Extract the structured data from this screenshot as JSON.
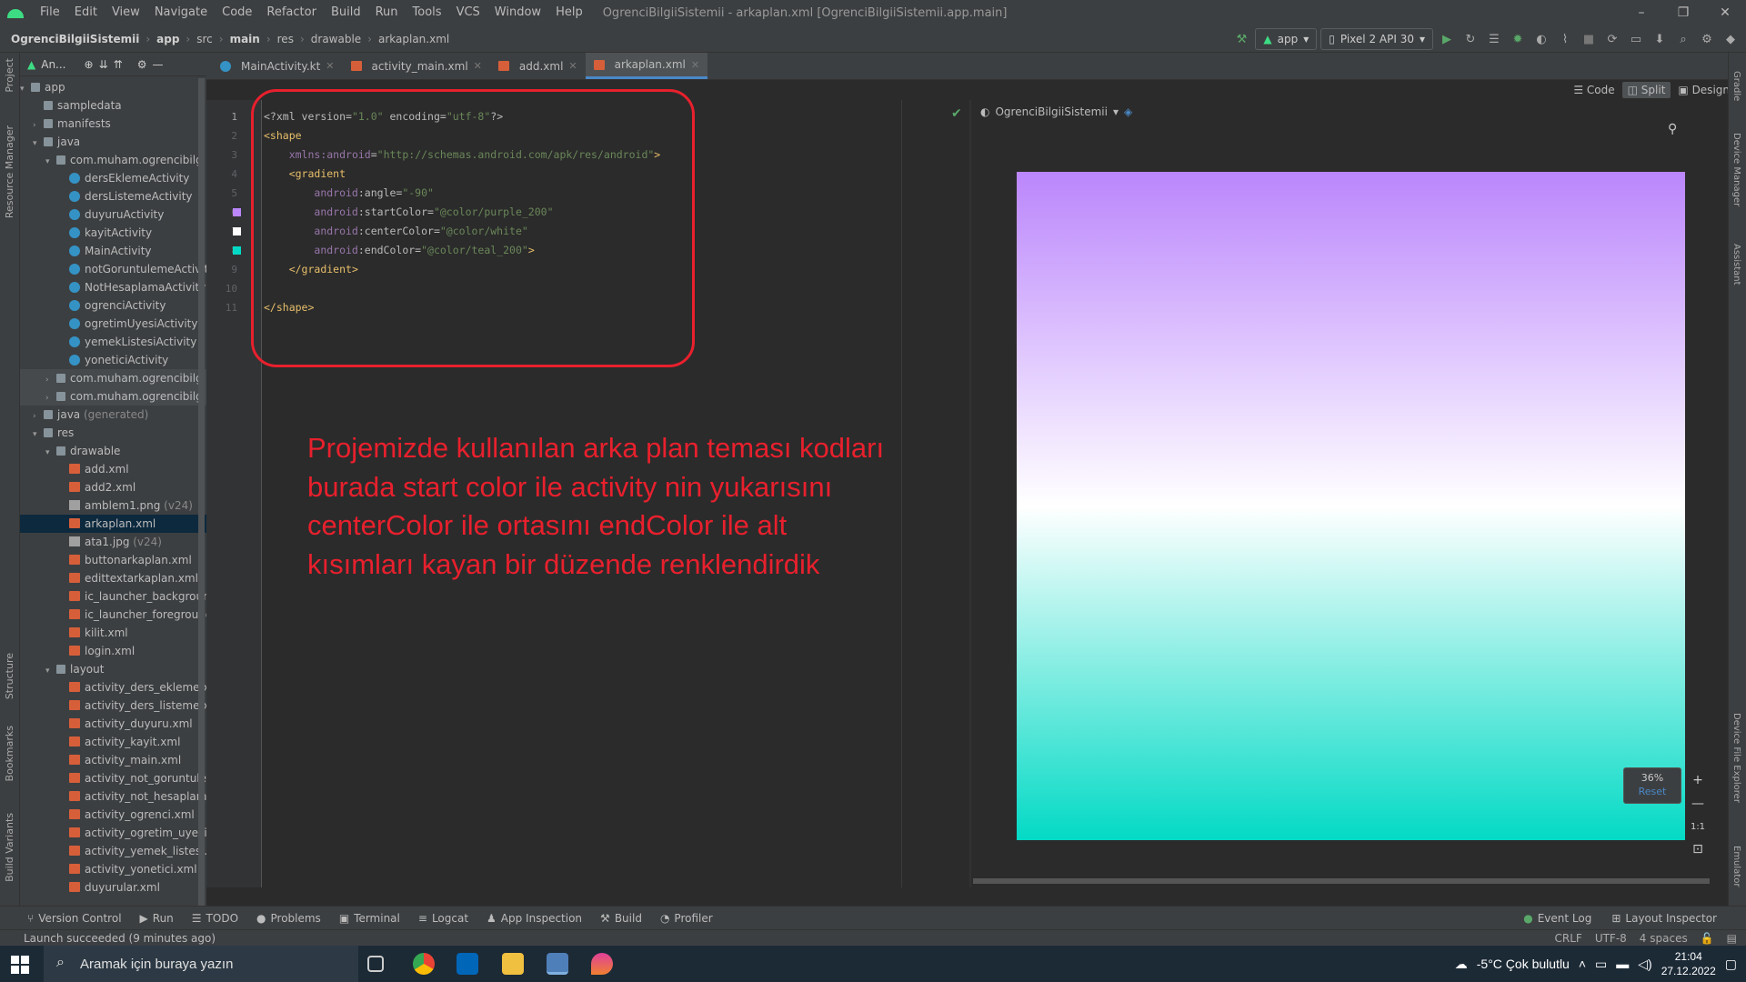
{
  "window": {
    "menu": [
      "File",
      "Edit",
      "View",
      "Navigate",
      "Code",
      "Refactor",
      "Build",
      "Run",
      "Tools",
      "VCS",
      "Window",
      "Help"
    ],
    "title": "OgrenciBilgiiSistemii - arkaplan.xml [OgrenciBilgiiSistemii.app.main]",
    "controls": [
      "–",
      "❐",
      "✕"
    ]
  },
  "breadcrumb": [
    "OgrenciBilgiiSistemii",
    "app",
    "src",
    "main",
    "res",
    "drawable",
    "arkaplan.xml"
  ],
  "run_config": {
    "module": "app",
    "device": "Pixel 2 API 30"
  },
  "project_panel": {
    "header": "An...",
    "tree": [
      {
        "label": "app",
        "indent": 0,
        "type": "folder",
        "arrow": "▾"
      },
      {
        "label": "sampledata",
        "indent": 1,
        "type": "folder",
        "arrow": ""
      },
      {
        "label": "manifests",
        "indent": 1,
        "type": "folder",
        "arrow": "›"
      },
      {
        "label": "java",
        "indent": 1,
        "type": "folder",
        "arrow": "▾"
      },
      {
        "label": "com.muham.ogrencibilgiisist",
        "indent": 2,
        "type": "folder",
        "arrow": "▾"
      },
      {
        "label": "dersEklemeActivity",
        "indent": 3,
        "type": "kt"
      },
      {
        "label": "dersListemeActivity",
        "indent": 3,
        "type": "kt"
      },
      {
        "label": "duyuruActivity",
        "indent": 3,
        "type": "kt"
      },
      {
        "label": "kayitActivity",
        "indent": 3,
        "type": "kt"
      },
      {
        "label": "MainActivity",
        "indent": 3,
        "type": "kt"
      },
      {
        "label": "notGoruntulemeActivity",
        "indent": 3,
        "type": "kt"
      },
      {
        "label": "NotHesaplamaActivity",
        "indent": 3,
        "type": "kt"
      },
      {
        "label": "ogrenciActivity",
        "indent": 3,
        "type": "kt"
      },
      {
        "label": "ogretimUyesiActivity",
        "indent": 3,
        "type": "kt"
      },
      {
        "label": "yemekListesiActivity",
        "indent": 3,
        "type": "kt"
      },
      {
        "label": "yoneticiActivity",
        "indent": 3,
        "type": "kt"
      },
      {
        "label": "com.muham.ogrencibilgiisist",
        "indent": 2,
        "type": "folder",
        "arrow": "›",
        "alt": true
      },
      {
        "label": "com.muham.ogrencibilgiisist",
        "indent": 2,
        "type": "folder",
        "arrow": "›",
        "alt": true
      },
      {
        "label": "java",
        "suffix": " (generated)",
        "indent": 1,
        "type": "folder",
        "arrow": "›"
      },
      {
        "label": "res",
        "indent": 1,
        "type": "folder",
        "arrow": "▾"
      },
      {
        "label": "drawable",
        "indent": 2,
        "type": "folder",
        "arrow": "▾"
      },
      {
        "label": "add.xml",
        "indent": 3,
        "type": "xml"
      },
      {
        "label": "add2.xml",
        "indent": 3,
        "type": "xml"
      },
      {
        "label": "amblem1.png",
        "suffix": " (v24)",
        "indent": 3,
        "type": "img"
      },
      {
        "label": "arkaplan.xml",
        "indent": 3,
        "type": "xml",
        "selected": true
      },
      {
        "label": "ata1.jpg",
        "suffix": " (v24)",
        "indent": 3,
        "type": "img"
      },
      {
        "label": "buttonarkaplan.xml",
        "indent": 3,
        "type": "xml"
      },
      {
        "label": "edittextarkaplan.xml",
        "indent": 3,
        "type": "xml"
      },
      {
        "label": "ic_launcher_background.x",
        "indent": 3,
        "type": "xml"
      },
      {
        "label": "ic_launcher_foreground.x",
        "indent": 3,
        "type": "xml"
      },
      {
        "label": "kilit.xml",
        "indent": 3,
        "type": "xml"
      },
      {
        "label": "login.xml",
        "indent": 3,
        "type": "xml"
      },
      {
        "label": "layout",
        "indent": 2,
        "type": "folder",
        "arrow": "▾"
      },
      {
        "label": "activity_ders_ekleme.xml",
        "indent": 3,
        "type": "xml"
      },
      {
        "label": "activity_ders_listeme.xml",
        "indent": 3,
        "type": "xml"
      },
      {
        "label": "activity_duyuru.xml",
        "indent": 3,
        "type": "xml"
      },
      {
        "label": "activity_kayit.xml",
        "indent": 3,
        "type": "xml"
      },
      {
        "label": "activity_main.xml",
        "indent": 3,
        "type": "xml"
      },
      {
        "label": "activity_not_goruntuleme",
        "indent": 3,
        "type": "xml"
      },
      {
        "label": "activity_not_hesaplama.xr",
        "indent": 3,
        "type": "xml"
      },
      {
        "label": "activity_ogrenci.xml",
        "indent": 3,
        "type": "xml"
      },
      {
        "label": "activity_ogretim_uyesi.xm",
        "indent": 3,
        "type": "xml"
      },
      {
        "label": "activity_yemek_listesi.xml",
        "indent": 3,
        "type": "xml"
      },
      {
        "label": "activity_yonetici.xml",
        "indent": 3,
        "type": "xml"
      },
      {
        "label": "duyurular.xml",
        "indent": 3,
        "type": "xml"
      }
    ]
  },
  "left_strip": [
    "Project",
    "Resource Manager",
    "Structure",
    "Bookmarks",
    "Build Variants"
  ],
  "right_strip": [
    "Gradle",
    "Device Manager",
    "Assistant",
    "Device File Explorer",
    "Emulator"
  ],
  "tabs": [
    {
      "label": "MainActivity.kt",
      "icon": "kotlin-icon"
    },
    {
      "label": "activity_main.xml",
      "icon": "xml-icon"
    },
    {
      "label": "add.xml",
      "icon": "xml-icon"
    },
    {
      "label": "arkaplan.xml",
      "icon": "xml-icon",
      "active": true
    }
  ],
  "view_modes": [
    "Code",
    "Split",
    "Design"
  ],
  "code_lines": [
    {
      "n": "1",
      "parts": [
        [
          "t-pi",
          "<?xml "
        ],
        [
          "t-attr",
          "version="
        ],
        [
          "t-val",
          "\"1.0\""
        ],
        [
          "t-attr",
          " encoding="
        ],
        [
          "t-val",
          "\"utf-8\""
        ],
        [
          "t-pi",
          "?>"
        ]
      ]
    },
    {
      "n": "2",
      "parts": [
        [
          "t-tag",
          "<shape"
        ]
      ]
    },
    {
      "n": "3",
      "parts": [
        [
          "t-attr",
          "    "
        ],
        [
          "t-ns",
          "xmlns:android"
        ],
        [
          "t-attr",
          "="
        ],
        [
          "t-val",
          "\"http://schemas.android.com/apk/res/android\""
        ],
        [
          "t-tag",
          ">"
        ]
      ]
    },
    {
      "n": "4",
      "parts": [
        [
          "t-attr",
          "    "
        ],
        [
          "t-tag",
          "<gradient"
        ]
      ]
    },
    {
      "n": "5",
      "parts": [
        [
          "t-attr",
          "        "
        ],
        [
          "t-ns",
          "android"
        ],
        [
          "t-attr",
          ":angle="
        ],
        [
          "t-val",
          "\"-90\""
        ]
      ]
    },
    {
      "n": "6",
      "parts": [
        [
          "t-attr",
          "        "
        ],
        [
          "t-ns",
          "android"
        ],
        [
          "t-attr",
          ":startColor="
        ],
        [
          "t-val",
          "\"@color/purple_200\""
        ]
      ]
    },
    {
      "n": "7",
      "parts": [
        [
          "t-attr",
          "        "
        ],
        [
          "t-ns",
          "android"
        ],
        [
          "t-attr",
          ":centerColor="
        ],
        [
          "t-val",
          "\"@color/white\""
        ]
      ]
    },
    {
      "n": "8",
      "parts": [
        [
          "t-attr",
          "        "
        ],
        [
          "t-ns",
          "android"
        ],
        [
          "t-attr",
          ":endColor="
        ],
        [
          "t-val",
          "\"@color/teal_200\""
        ],
        [
          "t-tag",
          ">"
        ]
      ]
    },
    {
      "n": "9",
      "parts": [
        [
          "t-attr",
          "    "
        ],
        [
          "t-tag",
          "</gradient>"
        ]
      ]
    },
    {
      "n": "10",
      "parts": []
    },
    {
      "n": "11",
      "parts": [
        [
          "t-tag",
          "</shape>"
        ]
      ]
    }
  ],
  "gutter_colors": [
    {
      "line": 6,
      "color": "#bb86fc"
    },
    {
      "line": 7,
      "color": "#ffffff"
    },
    {
      "line": 8,
      "color": "#03dac5"
    }
  ],
  "annotation": "Projemizde kullanılan arka plan teması kodları burada start color ile activity nin yukarısını centerColor ile ortasını endColor ile alt kısımları kayan bir düzende renklendirdik",
  "preview": {
    "theme": "OgrenciBilgiiSistemii",
    "zoom": "36%",
    "reset": "Reset",
    "ratio": "1:1",
    "gradient": {
      "start": "#bb86fc",
      "center": "#ffffff",
      "end": "#03dac5"
    }
  },
  "bottom_tools": [
    "Version Control",
    "Run",
    "TODO",
    "Problems",
    "Terminal",
    "Logcat",
    "App Inspection",
    "Build",
    "Profiler"
  ],
  "bottom_right": [
    "Event Log",
    "Layout Inspector"
  ],
  "status": {
    "message": "Launch succeeded (9 minutes ago)",
    "right": [
      "CRLF",
      "UTF-8",
      "4 spaces"
    ]
  },
  "taskbar": {
    "search_placeholder": "Aramak için buraya yazın",
    "weather": "-5°C  Çok bulutlu",
    "time": "21:04",
    "date": "27.12.2022"
  },
  "accent": "#4a88c7",
  "annotation_color": "#e8202d"
}
